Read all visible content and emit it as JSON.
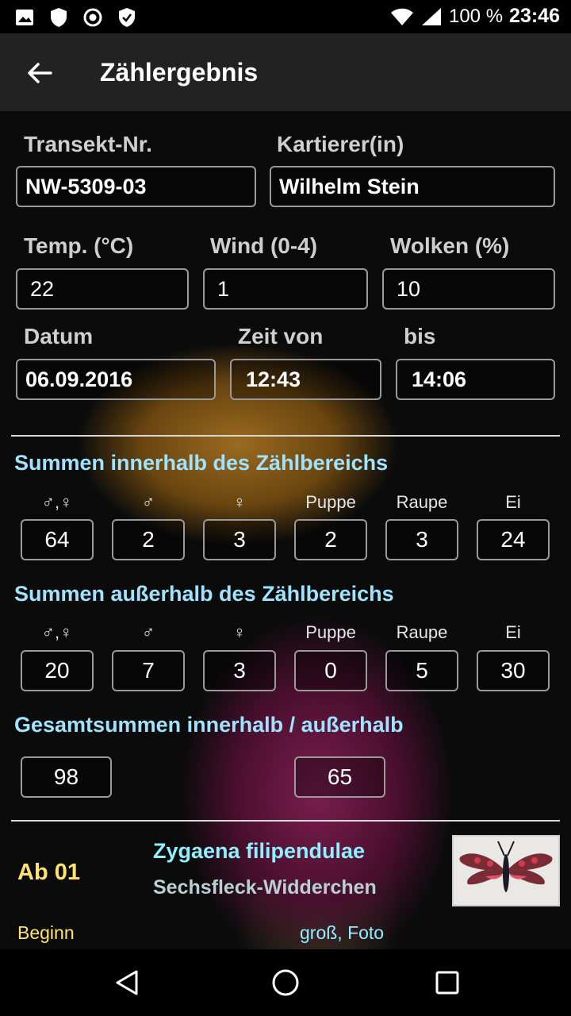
{
  "status_bar": {
    "icons": [
      "image-icon",
      "shield-icon",
      "record-icon",
      "shield-check-icon"
    ],
    "battery": "100 %",
    "time": "23:46"
  },
  "toolbar": {
    "title": "Zählergebnis",
    "back_icon": "arrow-left-icon"
  },
  "header": {
    "transect_label": "Transekt-Nr.",
    "transect_value": "NW-5309-03",
    "recorder_label": "Kartierer(in)",
    "recorder_value": "Wilhelm Stein",
    "temp_label": "Temp. (°C)",
    "temp_value": "22",
    "wind_label": "Wind (0-4)",
    "wind_value": "1",
    "clouds_label": "Wolken (%)",
    "clouds_value": "10",
    "date_label": "Datum",
    "date_value": "06.09.2016",
    "time_from_label": "Zeit von",
    "time_from_value": "12:43",
    "time_to_label": "bis",
    "time_to_value": "14:06"
  },
  "inside": {
    "title": "Summen innerhalb des Zählbereichs",
    "labels": [
      "♂,♀",
      "♂",
      "♀",
      "Puppe",
      "Raupe",
      "Ei"
    ],
    "values": [
      "64",
      "2",
      "3",
      "2",
      "3",
      "24"
    ]
  },
  "outside": {
    "title": "Summen außerhalb des Zählbereichs",
    "labels": [
      "♂,♀",
      "♂",
      "♀",
      "Puppe",
      "Raupe",
      "Ei"
    ],
    "values": [
      "20",
      "7",
      "3",
      "0",
      "5",
      "30"
    ]
  },
  "totals": {
    "title": "Gesamtsummen innerhalb / außerhalb",
    "inside": "98",
    "outside": "65"
  },
  "species": {
    "section": "Ab 01",
    "latin": "Zygaena filipendulae",
    "german": "Sechsfleck-Widderchen",
    "left_note": "Beginn",
    "right_note": "groß, Foto"
  },
  "colors": {
    "accent_cyan": "#9fe3ff",
    "accent_yellow": "#ffe36b",
    "species_cyan": "#8ff0ff"
  },
  "nav": {
    "back_icon": "triangle-back-icon",
    "home_icon": "circle-home-icon",
    "recents_icon": "square-recents-icon"
  }
}
